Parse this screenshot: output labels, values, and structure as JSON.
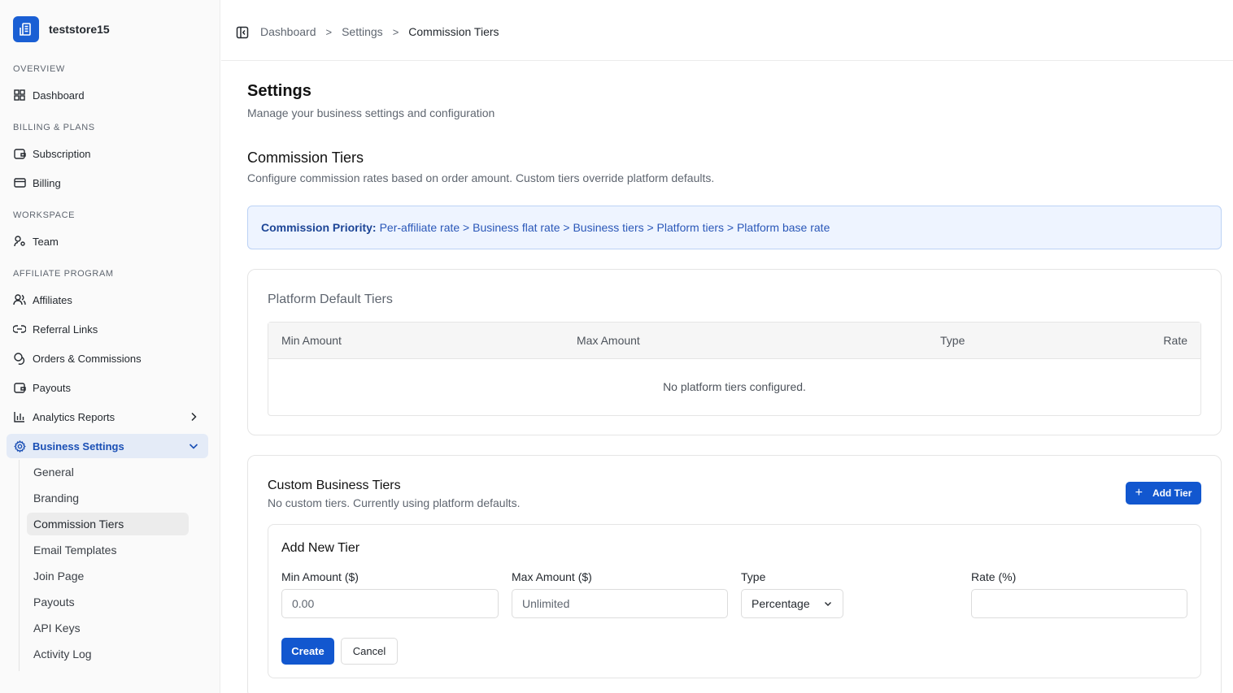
{
  "sidebar": {
    "store_name": "teststore15",
    "sections": {
      "overview": "OVERVIEW",
      "billing": "BILLING & PLANS",
      "workspace": "WORKSPACE",
      "affiliate": "AFFILIATE PROGRAM"
    },
    "items": {
      "dashboard": "Dashboard",
      "subscription": "Subscription",
      "billing": "Billing",
      "team": "Team",
      "affiliates": "Affiliates",
      "referral_links": "Referral Links",
      "orders": "Orders & Commissions",
      "payouts": "Payouts",
      "analytics": "Analytics Reports",
      "business_settings": "Business Settings"
    },
    "sub_items": {
      "general": "General",
      "branding": "Branding",
      "commission_tiers": "Commission Tiers",
      "email_templates": "Email Templates",
      "join_page": "Join Page",
      "payouts": "Payouts",
      "api_keys": "API Keys",
      "activity_log": "Activity Log"
    }
  },
  "breadcrumb": {
    "items": [
      "Dashboard",
      "Settings",
      "Commission Tiers"
    ],
    "separator": ">"
  },
  "page": {
    "title": "Settings",
    "subtitle": "Manage your business settings and configuration"
  },
  "commission": {
    "title": "Commission Tiers",
    "subtitle": "Configure commission rates based on order amount. Custom tiers override platform defaults.",
    "priority_label": "Commission Priority:",
    "priority_text": "Per-affiliate rate > Business flat rate > Business tiers > Platform tiers > Platform base rate"
  },
  "platform_tiers": {
    "title": "Platform Default Tiers",
    "columns": [
      "Min Amount",
      "Max Amount",
      "Type",
      "Rate"
    ],
    "empty": "No platform tiers configured."
  },
  "custom_tiers": {
    "title": "Custom Business Tiers",
    "subtitle": "No custom tiers. Currently using platform defaults.",
    "add_button": "Add Tier"
  },
  "new_tier_form": {
    "title": "Add New Tier",
    "min_label": "Min Amount ($)",
    "min_placeholder": "0.00",
    "max_label": "Max Amount ($)",
    "max_placeholder": "Unlimited",
    "type_label": "Type",
    "type_value": "Percentage",
    "rate_label": "Rate (%)",
    "rate_value": "",
    "create_button": "Create",
    "cancel_button": "Cancel"
  },
  "colors": {
    "accent": "#1257cf",
    "active_bg": "#e4ebf7",
    "notice_bg": "#eef4ff"
  }
}
